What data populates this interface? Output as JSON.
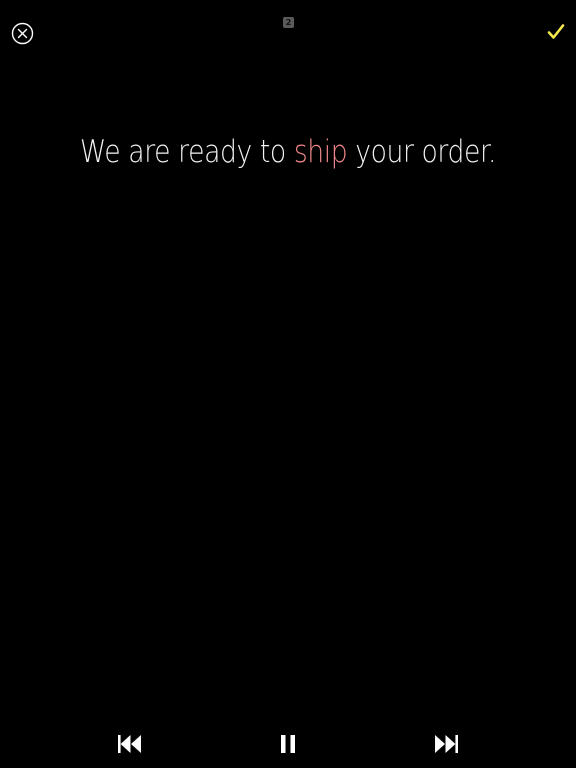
{
  "header": {
    "close_icon": "close-circle-icon",
    "page_badge": "2",
    "done_icon": "checkmark-icon",
    "done_color": "#f5e94a"
  },
  "message": {
    "before": "We are ready to ",
    "highlight": "ship",
    "after": " your order.",
    "highlight_color": "#f0878a"
  },
  "playback": {
    "previous_icon": "skip-back-icon",
    "pause_icon": "pause-icon",
    "next_icon": "skip-forward-icon"
  }
}
